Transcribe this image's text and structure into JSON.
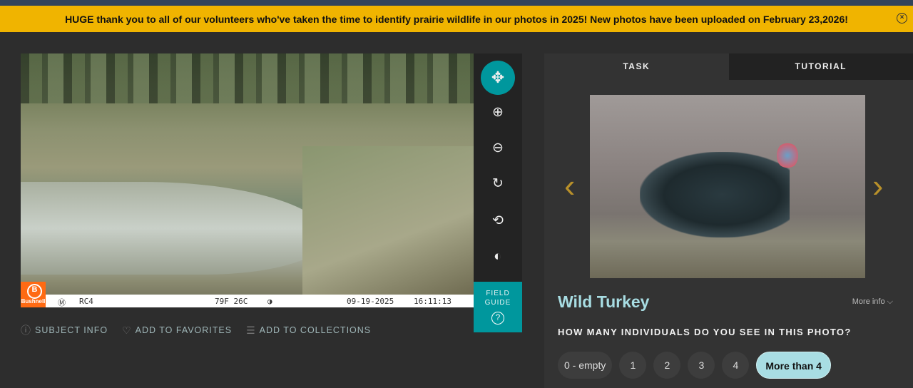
{
  "banner": {
    "message": "HUGE thank you to all of our volunteers who've taken the time to identify prairie wildlife in our photos in 2025! New photos have been uploaded on February 23,2026!",
    "close_icon": "×"
  },
  "camera_stamp": {
    "brand": "Bushnell",
    "mode": "Ⓜ",
    "camera_id": "RC4",
    "temperature": "79F 26C",
    "moon": "◑",
    "date": "09-19-2025",
    "time": "16:11:13"
  },
  "toolbar": {
    "move": "✥",
    "zoom_in": "⊕",
    "zoom_out": "⊖",
    "rotate": "↻",
    "reset": "⟲",
    "invert": "◐"
  },
  "field_guide": {
    "label_line1": "FIELD",
    "label_line2": "GUIDE",
    "icon": "?"
  },
  "meta_links": [
    {
      "icon": "ⓘ",
      "label": "SUBJECT INFO"
    },
    {
      "icon": "♡",
      "label": "ADD TO FAVORITES"
    },
    {
      "icon": "☰",
      "label": "ADD TO COLLECTIONS"
    }
  ],
  "tabs": [
    {
      "label": "TASK",
      "active": true
    },
    {
      "label": "TUTORIAL",
      "active": false
    }
  ],
  "species": {
    "name": "Wild Turkey",
    "more_info": "More info ⌵",
    "prev": "‹",
    "next": "›"
  },
  "question": "HOW MANY INDIVIDUALS DO YOU SEE IN THIS PHOTO?",
  "answers": [
    "0 - empty",
    "1",
    "2",
    "3",
    "4",
    "More than 4"
  ],
  "selected_answer": "More than 4",
  "colors": {
    "banner": "#f0b400",
    "accent": "#00979d",
    "selected": "#a8dde3"
  }
}
